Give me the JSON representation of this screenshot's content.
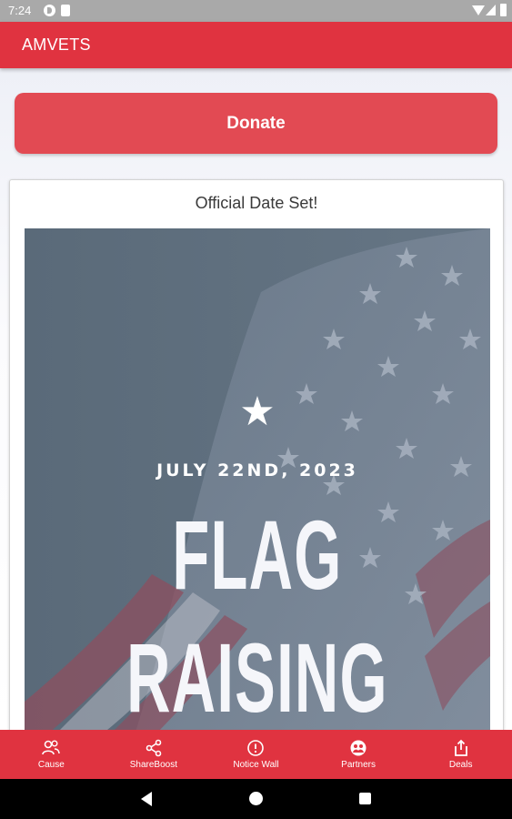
{
  "status_bar": {
    "time": "7:24",
    "icons": [
      "notification-p-icon",
      "sim-card-icon",
      "wifi-icon",
      "signal-icon",
      "battery-icon"
    ]
  },
  "app_bar": {
    "title": "AMVETS",
    "color": "#e03340"
  },
  "donate_button": {
    "label": "Donate",
    "color": "#e24a53"
  },
  "post": {
    "title": "Official Date Set!",
    "image": {
      "star": "★",
      "date": "JULY 22ND, 2023",
      "headline_line1": "FLAG",
      "headline_line2": "RAISING"
    }
  },
  "bottom_nav": {
    "items": [
      {
        "label": "Cause",
        "icon": "people-icon"
      },
      {
        "label": "ShareBoost",
        "icon": "share-icon"
      },
      {
        "label": "Notice Wall",
        "icon": "alert-circle-icon"
      },
      {
        "label": "Partners",
        "icon": "partners-icon"
      },
      {
        "label": "Deals",
        "icon": "upload-box-icon"
      }
    ]
  },
  "system_nav": {
    "buttons": [
      "back-icon",
      "home-icon",
      "recents-icon"
    ]
  }
}
